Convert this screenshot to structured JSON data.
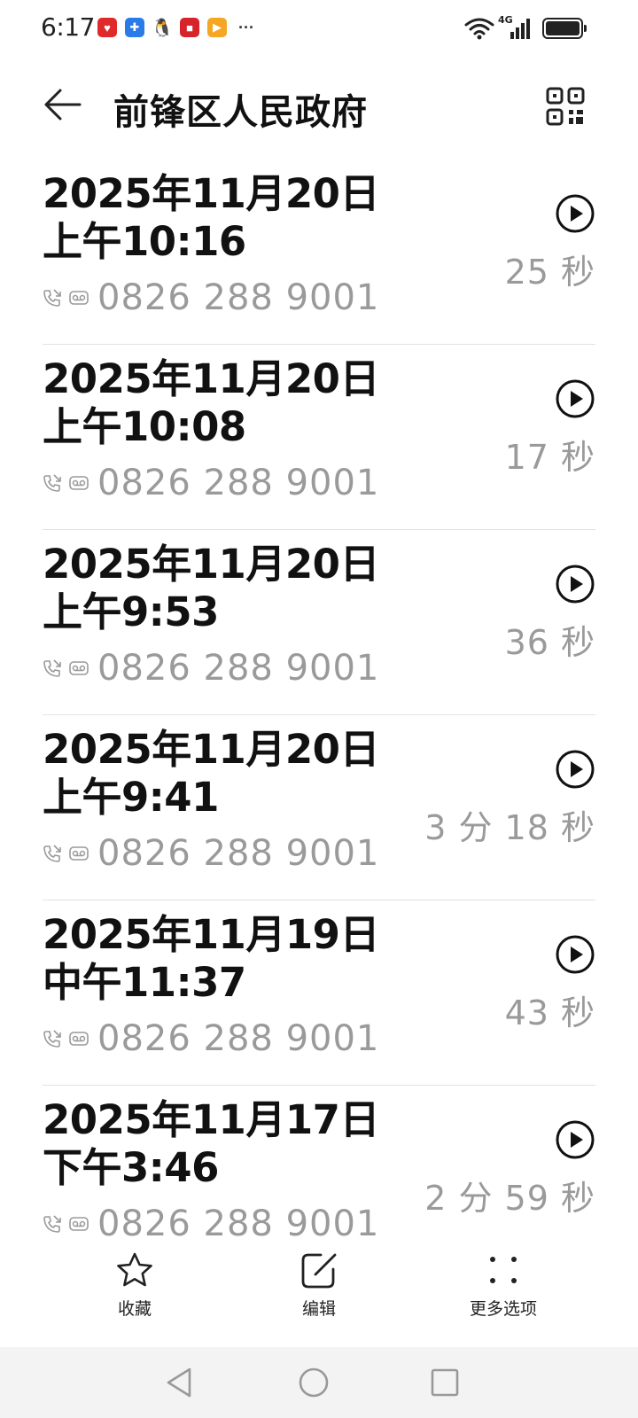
{
  "status_bar": {
    "time": "6:17",
    "network_label": "4G",
    "notification_icons": [
      "app-red-icon",
      "app-blue-icon",
      "qq-icon",
      "app-red2-icon",
      "app-orange-icon"
    ],
    "more_label": "···"
  },
  "header": {
    "title": "前锋区人民政府"
  },
  "records": [
    {
      "date": "2025年11月20日",
      "time": "上午10:16",
      "number": "0826 288 9001",
      "duration": "25 秒"
    },
    {
      "date": "2025年11月20日",
      "time": "上午10:08",
      "number": "0826 288 9001",
      "duration": "17 秒"
    },
    {
      "date": "2025年11月20日",
      "time": "上午9:53",
      "number": "0826 288 9001",
      "duration": "36 秒"
    },
    {
      "date": "2025年11月20日",
      "time": "上午9:41",
      "number": "0826 288 9001",
      "duration": "3 分 18 秒"
    },
    {
      "date": "2025年11月19日",
      "time": "中午11:37",
      "number": "0826 288 9001",
      "duration": "43 秒"
    },
    {
      "date": "2025年11月17日",
      "time": "下午3:46",
      "number": "0826 288 9001",
      "duration": "2 分 59 秒"
    }
  ],
  "toolbar": {
    "favorite_label": "收藏",
    "edit_label": "编辑",
    "more_label": "更多选项"
  },
  "colors": {
    "text_primary": "#111111",
    "text_secondary": "#9a9a9a",
    "divider": "#e2e2e2",
    "nav_bar_bg": "#f3f3f3"
  }
}
